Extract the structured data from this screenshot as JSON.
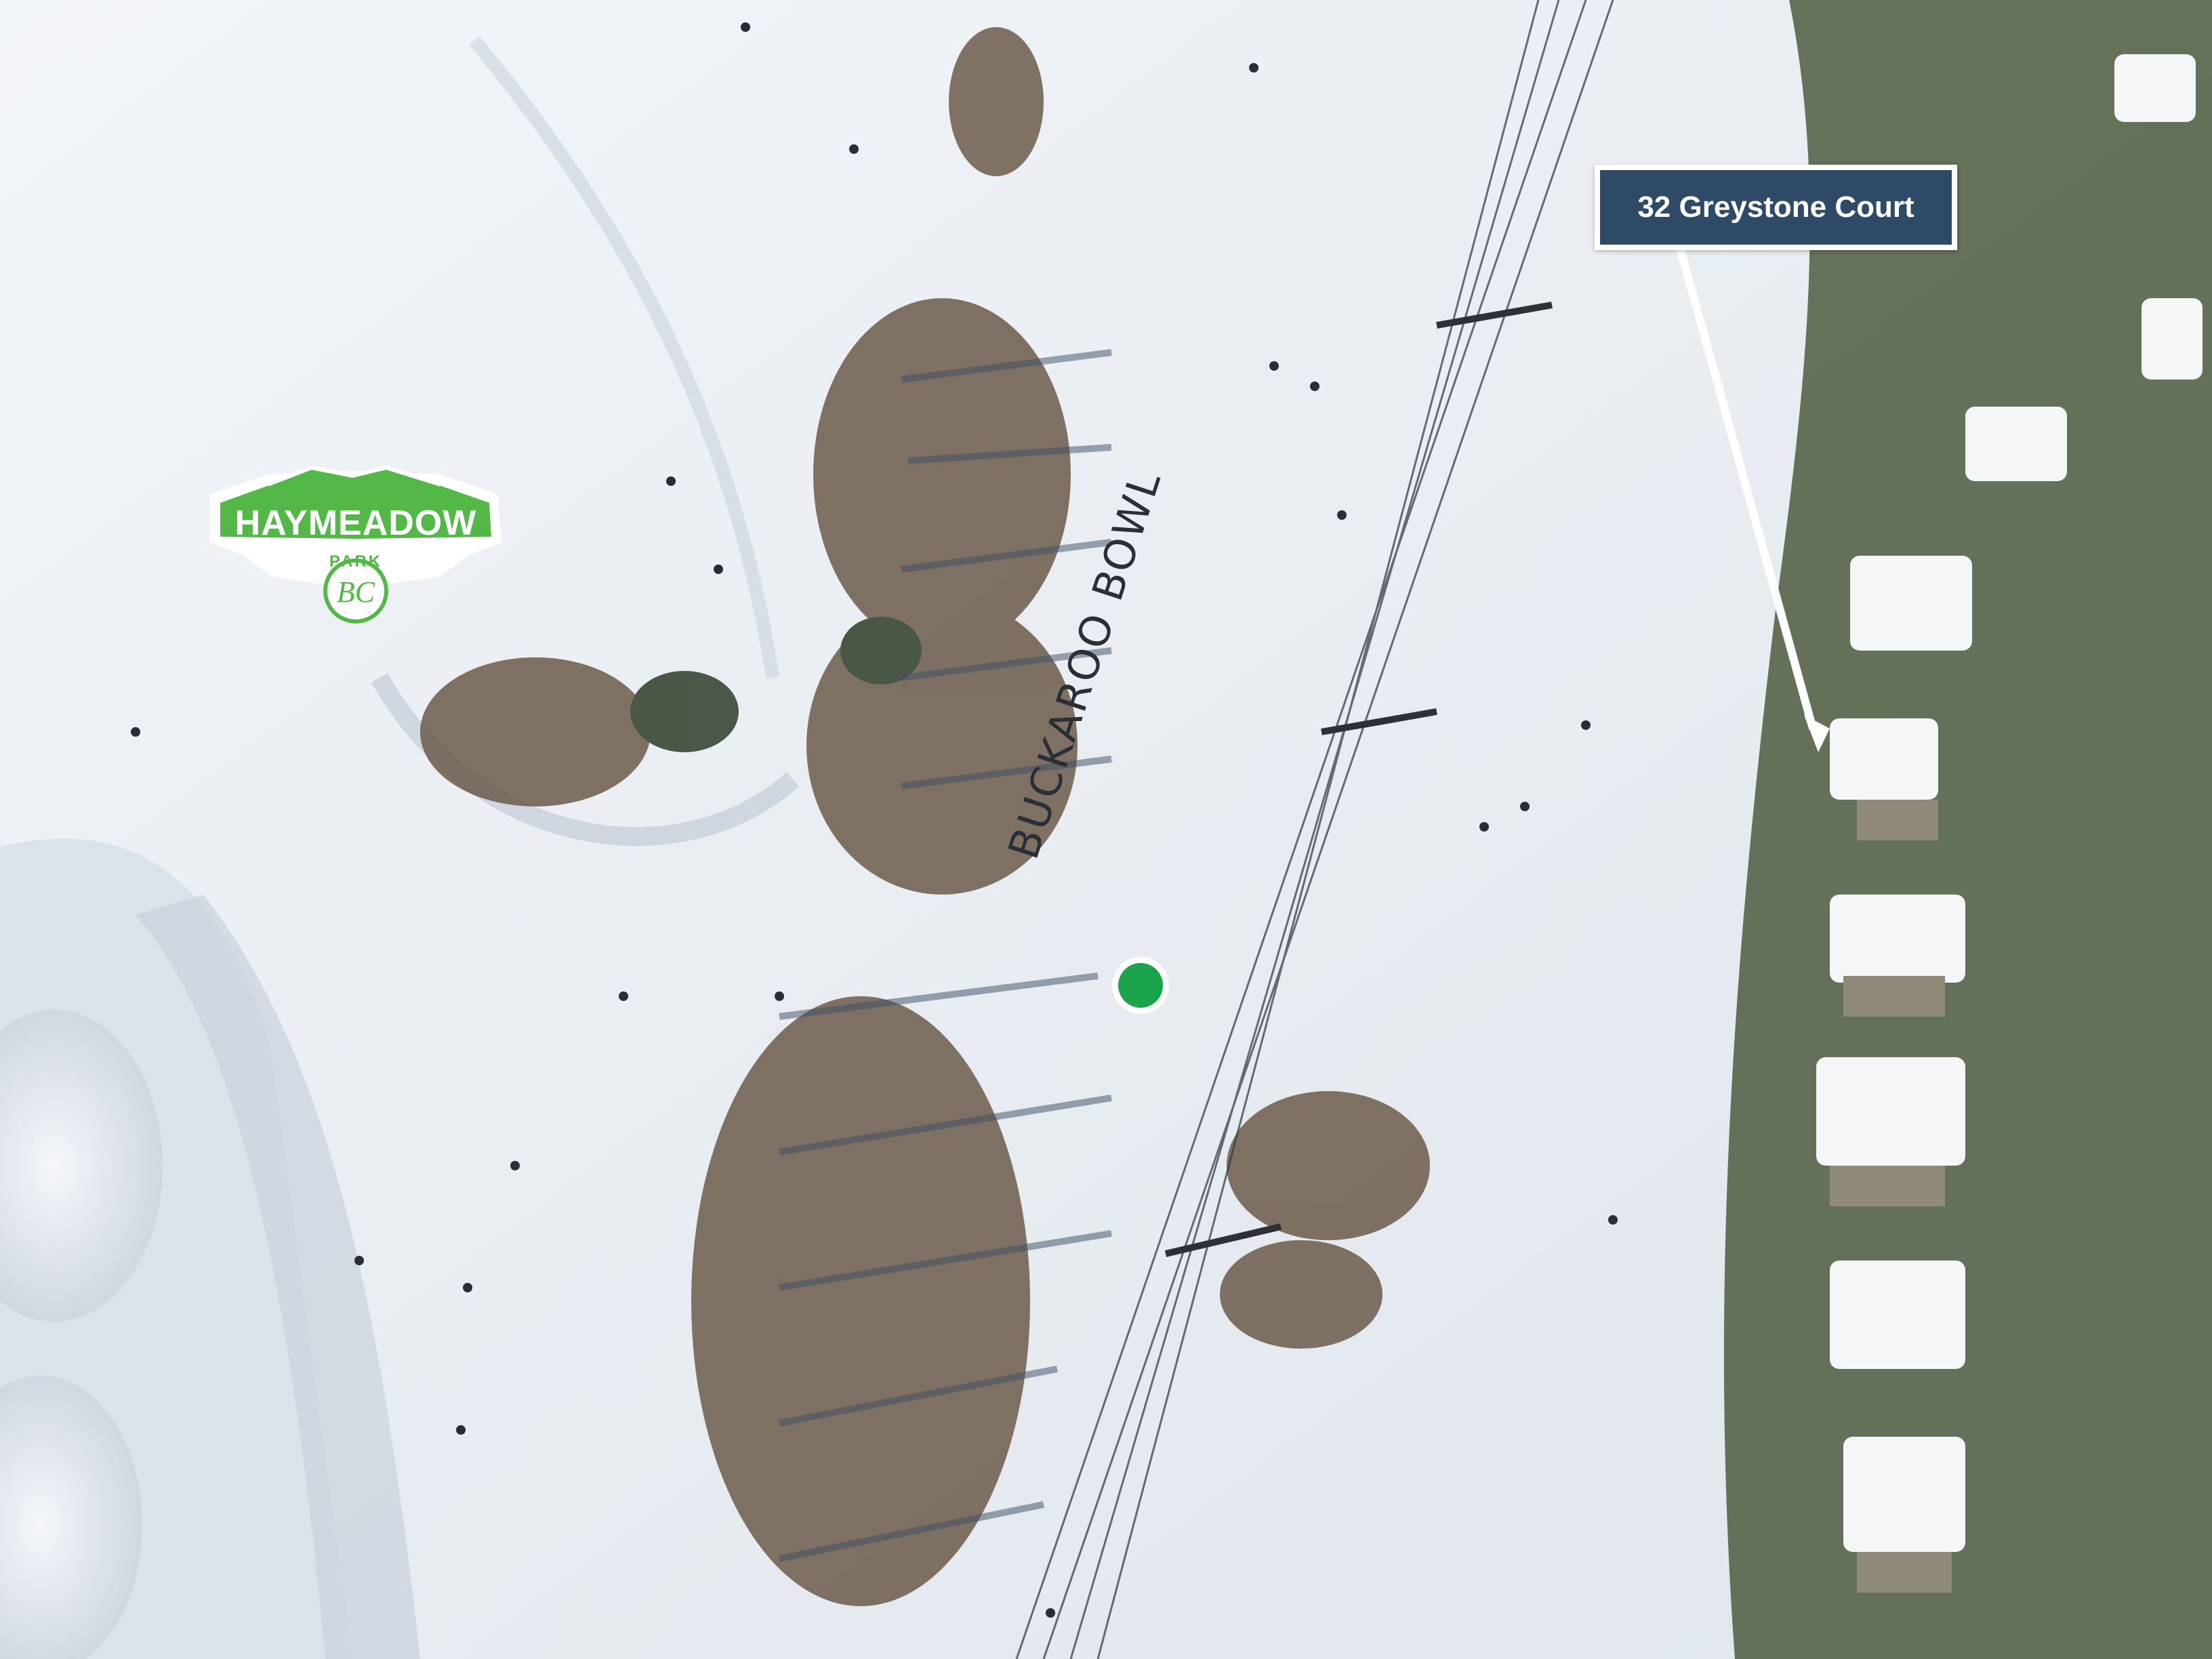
{
  "map": {
    "view": "aerial photo of ski slope",
    "logo": {
      "title": "HAYMEADOW",
      "subtitle": "PARK",
      "brand_color": "#54b848"
    },
    "run_label": "BUCKAROO BOWL",
    "address_callout": "32 Greystone Court",
    "colors": {
      "callout_bg": "#2f4a66",
      "marker": "#1aa34a",
      "snow": "#e9eef3"
    }
  }
}
